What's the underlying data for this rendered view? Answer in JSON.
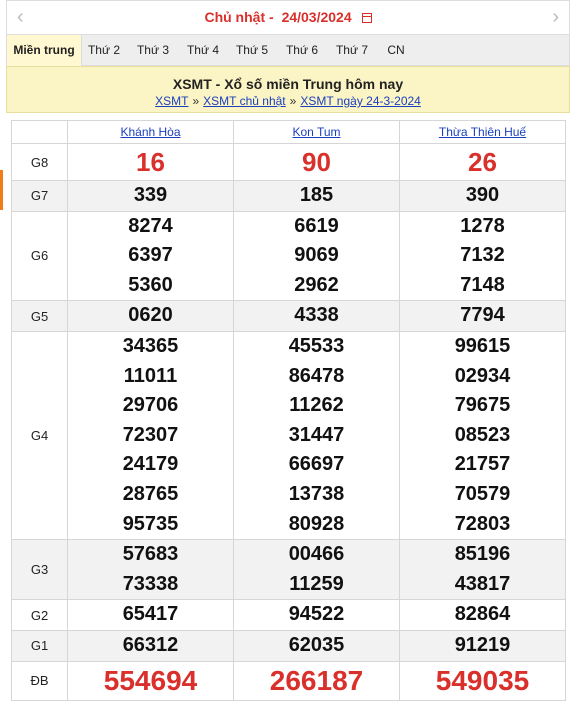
{
  "datebar": {
    "prefix": "Chủ nhật -",
    "date": "24/03/2024",
    "prev_glyph": "‹",
    "next_glyph": "›",
    "calendar_icon": "calendar-icon"
  },
  "tabs": [
    "Miền trung",
    "Thứ 2",
    "Thứ 3",
    "Thứ 4",
    "Thứ 5",
    "Thứ 6",
    "Thứ 7",
    "CN"
  ],
  "header": {
    "title": "XSMT - Xổ số miền Trung hôm nay",
    "breadcrumb": [
      "XSMT",
      "XSMT chủ nhật",
      "XSMT ngày 24-3-2024"
    ],
    "separator": "»"
  },
  "provinces": [
    "Khánh Hòa",
    "Kon Tum",
    "Thừa Thiên Huế"
  ],
  "prizes": [
    {
      "label": "G8",
      "values": [
        [
          "16"
        ],
        [
          "90"
        ],
        [
          "26"
        ]
      ]
    },
    {
      "label": "G7",
      "values": [
        [
          "339"
        ],
        [
          "185"
        ],
        [
          "390"
        ]
      ]
    },
    {
      "label": "G6",
      "values": [
        [
          "8274",
          "6397",
          "5360"
        ],
        [
          "6619",
          "9069",
          "2962"
        ],
        [
          "1278",
          "7132",
          "7148"
        ]
      ]
    },
    {
      "label": "G5",
      "values": [
        [
          "0620"
        ],
        [
          "4338"
        ],
        [
          "7794"
        ]
      ]
    },
    {
      "label": "G4",
      "values": [
        [
          "34365",
          "11011",
          "29706",
          "72307",
          "24179",
          "28765",
          "95735"
        ],
        [
          "45533",
          "86478",
          "11262",
          "31447",
          "66697",
          "13738",
          "80928"
        ],
        [
          "99615",
          "02934",
          "79675",
          "08523",
          "21757",
          "70579",
          "72803"
        ]
      ]
    },
    {
      "label": "G3",
      "values": [
        [
          "57683",
          "73338"
        ],
        [
          "00466",
          "11259"
        ],
        [
          "85196",
          "43817"
        ]
      ]
    },
    {
      "label": "G2",
      "values": [
        [
          "65417"
        ],
        [
          "94522"
        ],
        [
          "82864"
        ]
      ]
    },
    {
      "label": "G1",
      "values": [
        [
          "66312"
        ],
        [
          "62035"
        ],
        [
          "91219"
        ]
      ]
    },
    {
      "label": "ĐB",
      "values": [
        [
          "554694"
        ],
        [
          "266187"
        ],
        [
          "549035"
        ]
      ]
    }
  ],
  "colors": {
    "accent_red": "#d9302c",
    "link_blue": "#1a3fbf",
    "header_bg": "#fbf4c5"
  }
}
